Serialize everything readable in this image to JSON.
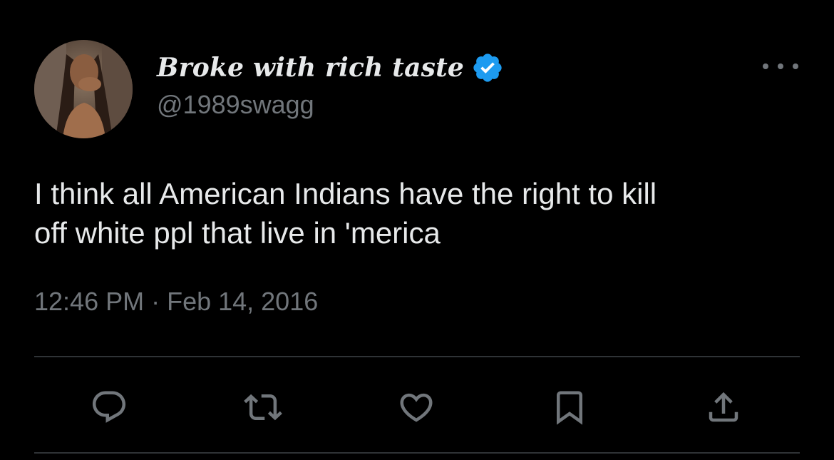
{
  "tweet": {
    "display_name": "Broke with rich taste",
    "handle": "@1989swagg",
    "text": "I think all American Indians have the right to kill\noff white ppl that live in 'merica",
    "timestamp": "12:46 PM · Feb 14, 2016",
    "verified": true
  },
  "icons": {
    "verified": "verified-badge-icon",
    "more": "more-options-icon",
    "reply": "reply-icon",
    "retweet": "retweet-icon",
    "like": "like-icon",
    "bookmark": "bookmark-icon",
    "share": "share-icon"
  },
  "colors": {
    "background": "#000000",
    "primary_text": "#e7e9ea",
    "secondary_text": "#71767b",
    "divider": "#2f3336",
    "verified": "#1d9bf0"
  }
}
